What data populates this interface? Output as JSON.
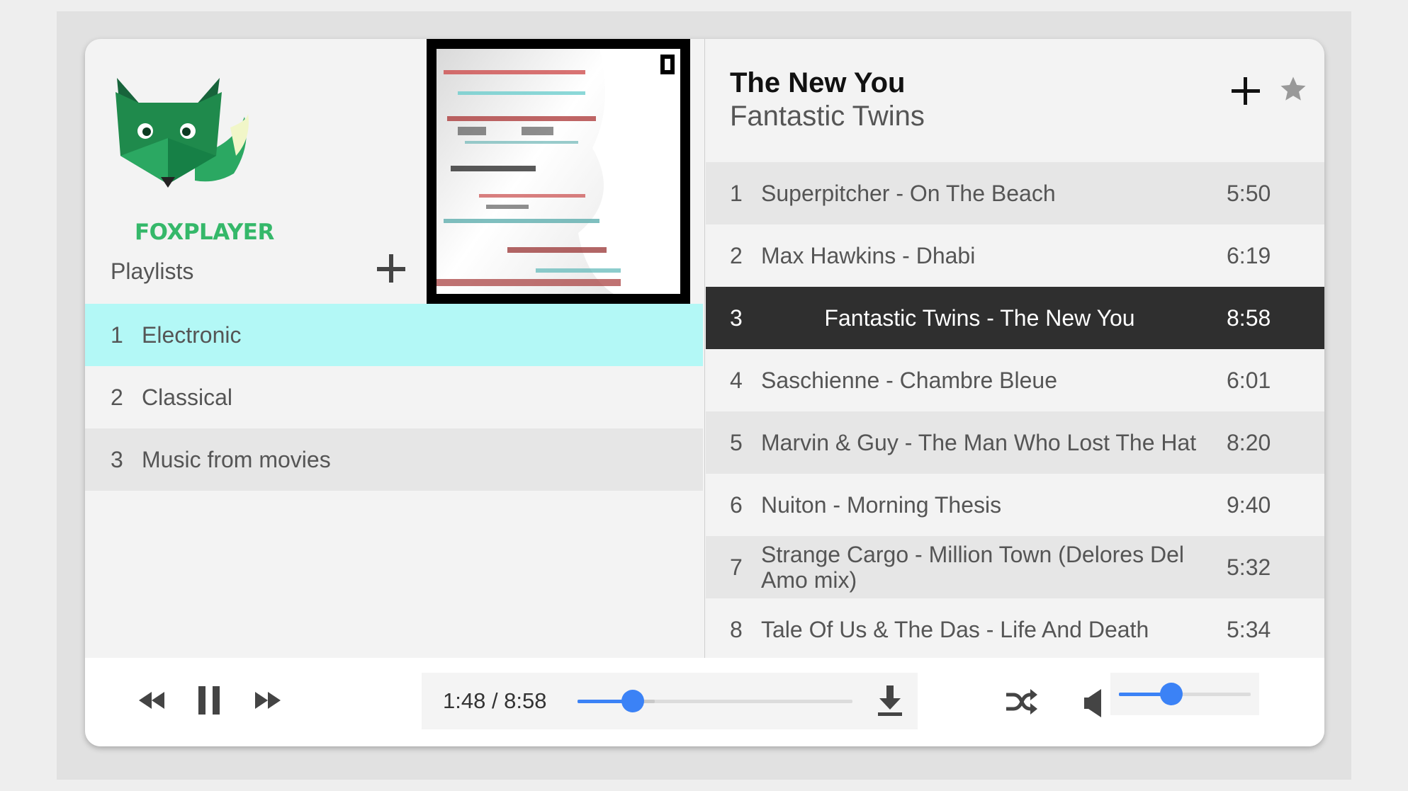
{
  "app": {
    "brand": "FOXPLAYER"
  },
  "playlists": {
    "label": "Playlists",
    "items": [
      {
        "num": "1",
        "name": "Electronic",
        "active": true
      },
      {
        "num": "2",
        "name": "Classical",
        "active": false
      },
      {
        "num": "3",
        "name": "Music from movies",
        "active": false
      }
    ]
  },
  "now_playing": {
    "title": "The New You",
    "artist": "Fantastic Twins"
  },
  "tracks": [
    {
      "num": "1",
      "name": "Superpitcher - On The Beach",
      "duration": "5:50"
    },
    {
      "num": "2",
      "name": "Max Hawkins - Dhabi",
      "duration": "6:19"
    },
    {
      "num": "3",
      "name": "Fantastic Twins - The New You",
      "duration": "8:58",
      "active": true
    },
    {
      "num": "4",
      "name": "Saschienne - Chambre Bleue",
      "duration": "6:01"
    },
    {
      "num": "5",
      "name": "Marvin & Guy - The Man Who Lost The Hat",
      "duration": "8:20"
    },
    {
      "num": "6",
      "name": "Nuiton - Morning Thesis",
      "duration": "9:40"
    },
    {
      "num": "7",
      "name": "Strange Cargo - Million Town (Delores Del Amo mix)",
      "duration": "5:32"
    },
    {
      "num": "8",
      "name": "Tale Of Us & The Das - Life And Death",
      "duration": "5:34"
    }
  ],
  "playback": {
    "time_display": "1:48 / 8:58",
    "progress_fraction": 0.2,
    "buffered_fraction": 0.28,
    "volume_fraction": 0.4
  },
  "colors": {
    "accent": "#3b82f6",
    "active_playlist": "#b3f8f6",
    "active_track": "#2f2f2f",
    "brand_green": "#35b86a"
  }
}
